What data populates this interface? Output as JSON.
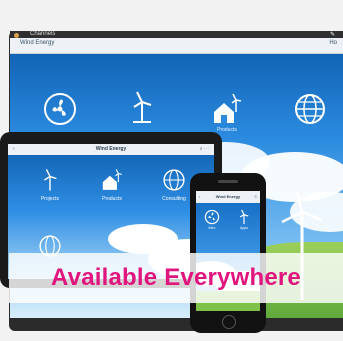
{
  "laptop": {
    "window_menu": "Channels",
    "app_title": "Wind Energy",
    "nav_right": "Ho",
    "tiles": [
      {
        "label": "",
        "icon": "fan-icon"
      },
      {
        "label": "",
        "icon": "wind-turbine-icon"
      },
      {
        "label": "Products",
        "icon": "house-turbine-icon"
      },
      {
        "label": "",
        "icon": "globe-icon"
      }
    ]
  },
  "tablet": {
    "app_title": "Wind Energy",
    "tiles": [
      {
        "label": "Projects",
        "icon": "wind-turbine-icon"
      },
      {
        "label": "Products",
        "icon": "house-turbine-icon"
      },
      {
        "label": "Consulting",
        "icon": "globe-icon"
      }
    ]
  },
  "phone": {
    "app_title": "Wind Energy",
    "tiles": [
      {
        "label": "Intro",
        "icon": "fan-icon"
      },
      {
        "label": "Apps",
        "icon": "wind-turbine-icon"
      }
    ]
  },
  "banner": {
    "text": "Available Everywhere"
  },
  "colors": {
    "banner_text": "#e0157e",
    "sky": "#1d78c8"
  }
}
